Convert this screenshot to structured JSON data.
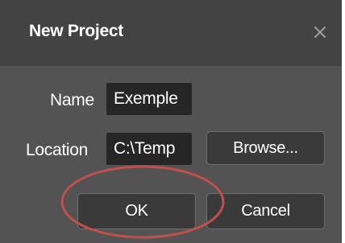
{
  "dialog": {
    "title": "New Project",
    "close_icon": "close-icon"
  },
  "form": {
    "name_label": "Name",
    "name_value": "Exemple",
    "location_label": "Location",
    "location_value": "C:\\Temp",
    "browse_label": "Browse..."
  },
  "actions": {
    "ok_label": "OK",
    "cancel_label": "Cancel"
  },
  "colors": {
    "dialog_bg": "#535353",
    "titlebar_bg": "#434343",
    "field_bg": "#262626",
    "annotation_ellipse": "#c0504d"
  }
}
